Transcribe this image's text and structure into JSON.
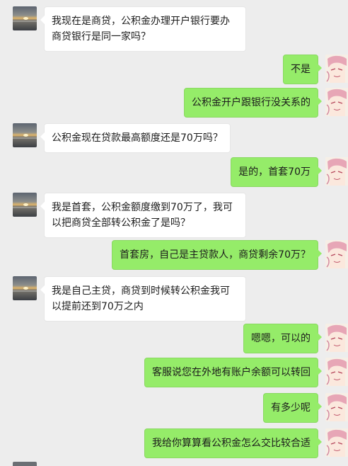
{
  "messages": [
    {
      "side": "left",
      "text": "我现在是商贷，公积金办理开户银行要办商贷银行是同一家吗？"
    },
    {
      "side": "right",
      "text": "不是"
    },
    {
      "side": "right",
      "text": "公积金开户跟银行没关系的"
    },
    {
      "side": "left",
      "text": "公积金现在贷款最高额度还是70万吗？"
    },
    {
      "side": "right",
      "text": "是的，首套70万"
    },
    {
      "side": "left",
      "text": "我是首套，公积金额度缴到70万了，我可以把商贷全部转公积金了是吗？"
    },
    {
      "side": "right",
      "text": "首套房，自己是主贷款人，商贷剩余70万？"
    },
    {
      "side": "left",
      "text": "我是自己主贷，商贷到时候转公积金我可以提前还到70万之内"
    },
    {
      "side": "right",
      "text": "嗯嗯，可以的"
    },
    {
      "side": "right",
      "text": "客服说您在外地有账户余额可以转回"
    },
    {
      "side": "right",
      "text": "有多少呢"
    },
    {
      "side": "right",
      "text": "我给你算算看公积金怎么交比较合适"
    }
  ],
  "colors": {
    "background": "#ededed",
    "incoming_bubble": "#ffffff",
    "outgoing_bubble": "#95ec69"
  },
  "icons": {
    "incoming_avatar": "sunset-sea-avatar",
    "outgoing_avatar": "anime-character-avatar"
  }
}
